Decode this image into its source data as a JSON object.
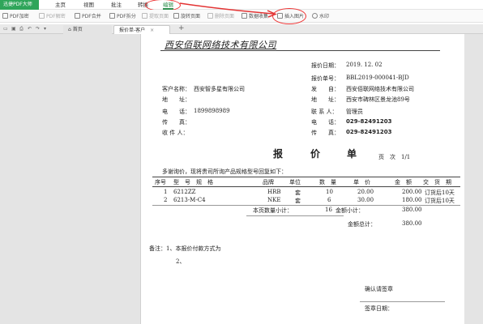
{
  "app": {
    "logo": "迅捷PDF大师"
  },
  "menu": [
    "主页",
    "视图",
    "批注",
    "转换",
    "编辑"
  ],
  "toolbar": [
    "PDF加密",
    "PDF解密",
    "PDF合并",
    "PDF拆分",
    "提取页面",
    "旋转页面",
    "删除页面",
    "数据收集",
    "插入图片",
    "水印"
  ],
  "tabs": {
    "home": "首页",
    "doc": "报价单-客户",
    "add": "+"
  },
  "doc": {
    "title": "西安佰联网络技术有限公司",
    "date_label": "报价日期：",
    "date_value": "2019. 12. 02",
    "no_label": "报价单号：",
    "no_value": "BBL2019-000041-BJD",
    "customer_label": "客户名称：",
    "customer_value": "西安智多星有限公司",
    "from_label": "发　　自：",
    "from_value": "西安佰联网络技术有限公司",
    "addr_label": "地　　址：",
    "addr2_label": "地　　址：",
    "addr2_value": "西安市碑林区景龙池89号",
    "phone_label": "电　　话：",
    "phone_value": "1899898989",
    "contact_label": "联 系 人：",
    "contact_value": "管理员",
    "phone2_label": "电　　话：",
    "phone2_value": "029-82491203",
    "fax_label": "传　　真：",
    "fax2_label": "传　　真：",
    "fax2_value": "029-82491203",
    "receiver_label": "收 件 人：",
    "big_title": [
      "报",
      "价",
      "单"
    ],
    "page_label": "页　次　1/1",
    "intro": "多谢询价，现将贵司所询产品规格型号回复如下：",
    "headers": [
      "序号",
      "型　号　规　格",
      "品牌",
      "单位",
      "数　量",
      "单　价",
      "金　额",
      "交　货　期"
    ],
    "rows": [
      [
        "1",
        "6212ZZ",
        "HRB",
        "套",
        "10",
        "20.00",
        "200.00",
        "订货后10天"
      ],
      [
        "2",
        "6213-M-C4",
        "NKE",
        "套",
        "6",
        "30.00",
        "180.00",
        "订货后10天"
      ]
    ],
    "subtotal_label": "本页数量小计：",
    "subtotal_qty": "16",
    "amount_sub_label": "金额小计：",
    "amount_sub_value": "380.00",
    "total_label": "金额总计：",
    "total_value": "380.00",
    "remark_label": "备注：1、本报价付款方式为",
    "remark_2": "2、",
    "confirm_label": "确认请签章",
    "sign_date_label": "签章日期："
  },
  "colors": {
    "annotation": "#e33333",
    "brand": "#2fa55a"
  }
}
